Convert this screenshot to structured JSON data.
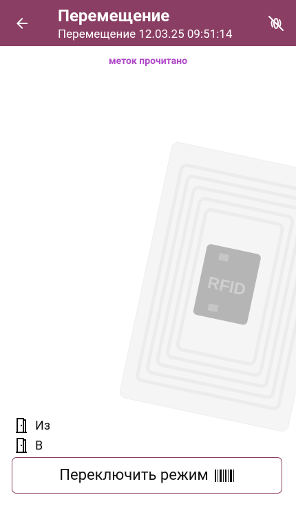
{
  "header": {
    "title": "Перемещение",
    "subtitle": "Перемещение 12.03.25 09:51:14",
    "back_icon": "arrow-left-icon",
    "nfc_icon": "nfc-off-icon",
    "background": "#8a3e63"
  },
  "main": {
    "read_count_label": "меток прочитано",
    "read_count_color": "#b048c8",
    "watermark_text": "RFID"
  },
  "fields": {
    "from_label": "Из",
    "to_label": "В",
    "icon": "door-icon"
  },
  "footer": {
    "switch_mode_label": "Переключить режим",
    "switch_mode_icon": "barcode-icon"
  }
}
